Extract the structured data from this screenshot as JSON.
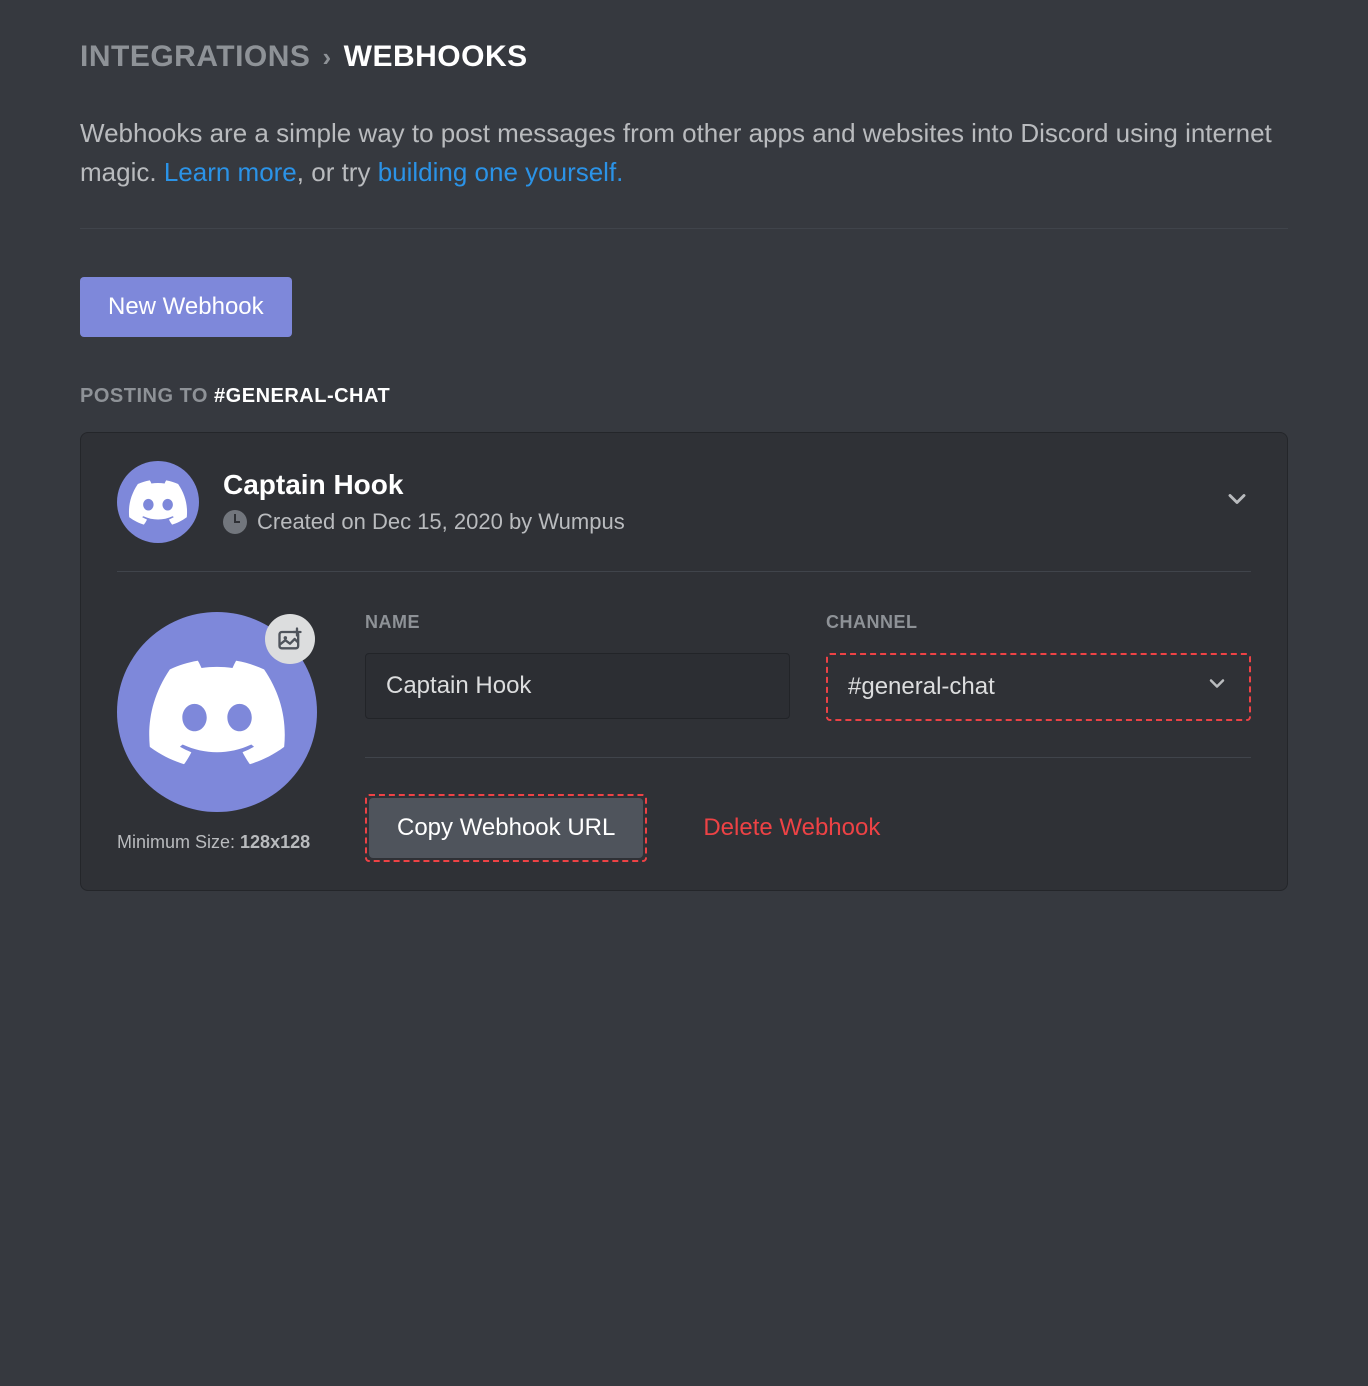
{
  "breadcrumb": {
    "parent": "INTEGRATIONS",
    "current": "WEBHOOKS"
  },
  "description": {
    "text_prefix": "Webhooks are a simple way to post messages from other apps and websites into Discord using internet magic. ",
    "learn_more": "Learn more",
    "text_mid": ", or try ",
    "build_link": "building one yourself."
  },
  "buttons": {
    "new_webhook": "New Webhook",
    "copy_url": "Copy Webhook URL",
    "delete": "Delete Webhook"
  },
  "posting": {
    "label": "POSTING TO ",
    "channel": "#GENERAL-CHAT"
  },
  "webhook": {
    "name": "Captain Hook",
    "created": "Created on Dec 15, 2020 by Wumpus",
    "name_label": "NAME",
    "name_value": "Captain Hook",
    "channel_label": "CHANNEL",
    "channel_value": "#general-chat",
    "size_hint_label": "Minimum Size: ",
    "size_hint_value": "128x128"
  }
}
